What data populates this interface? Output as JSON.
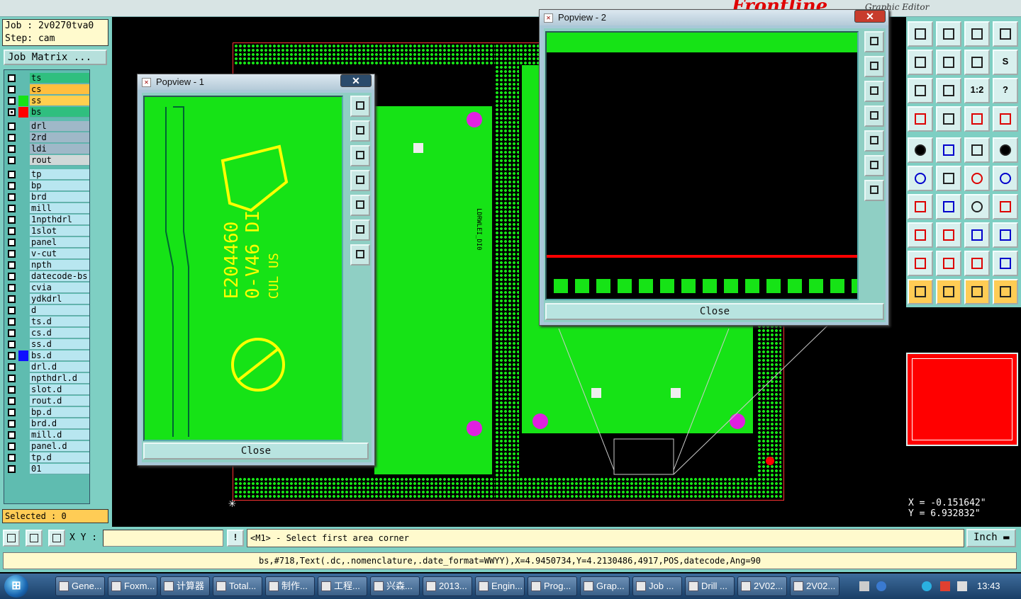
{
  "topbar": {
    "frontline": "Frontline",
    "subtitle": "Graphic Editor"
  },
  "left": {
    "job_line": "Job : 2v0270tva0",
    "step_line": "Step: cam",
    "job_matrix": "Job Matrix ...",
    "selected": "Selected : 0"
  },
  "layers": [
    {
      "name": "ts",
      "color": "#2fbf7f",
      "checked": false,
      "swatch": "",
      "mark": "◢"
    },
    {
      "name": "cs",
      "color": "#ffbf3f",
      "checked": false,
      "swatch": "",
      "mark": "◢"
    },
    {
      "name": "ss",
      "color": "#ffcf4f",
      "checked": false,
      "swatch": "#16e316",
      "mark": ""
    },
    {
      "name": "bs",
      "color": "#2fbf7f",
      "checked": true,
      "swatch": "#ff0000",
      "mark": "⊞"
    },
    {
      "name": "drl",
      "color": "#9fb8c8",
      "checked": false,
      "swatch": "",
      "mark": ""
    },
    {
      "name": "2rd",
      "color": "#9fb8c8",
      "checked": false,
      "swatch": "",
      "mark": ""
    },
    {
      "name": "ldi",
      "color": "#9fb8c8",
      "checked": false,
      "swatch": "",
      "mark": ""
    },
    {
      "name": "rout",
      "color": "#d0d8d8",
      "checked": false,
      "swatch": "",
      "mark": ""
    },
    {
      "name": "tp",
      "color": "#b8e6f0",
      "checked": false,
      "swatch": "",
      "mark": "◢"
    },
    {
      "name": "bp",
      "color": "#b8e6f0",
      "checked": false,
      "swatch": "",
      "mark": ""
    },
    {
      "name": "brd",
      "color": "#b8e6f0",
      "checked": false,
      "swatch": "",
      "mark": ""
    },
    {
      "name": "mill",
      "color": "#b8e6f0",
      "checked": false,
      "swatch": "",
      "mark": ""
    },
    {
      "name": "1npthdrl",
      "color": "#b8e6f0",
      "checked": false,
      "swatch": "",
      "mark": ""
    },
    {
      "name": "1slot",
      "color": "#b8e6f0",
      "checked": false,
      "swatch": "",
      "mark": ""
    },
    {
      "name": "panel",
      "color": "#b8e6f0",
      "checked": false,
      "swatch": "",
      "mark": ""
    },
    {
      "name": "v-cut",
      "color": "#b8e6f0",
      "checked": false,
      "swatch": "",
      "mark": ""
    },
    {
      "name": "npth",
      "color": "#b8e6f0",
      "checked": false,
      "swatch": "",
      "mark": ""
    },
    {
      "name": "datecode-bs",
      "color": "#b8e6f0",
      "checked": false,
      "swatch": "",
      "mark": ""
    },
    {
      "name": "cvia",
      "color": "#b8e6f0",
      "checked": false,
      "swatch": "",
      "mark": ""
    },
    {
      "name": "ydkdrl",
      "color": "#b8e6f0",
      "checked": false,
      "swatch": "",
      "mark": ""
    },
    {
      "name": "d",
      "color": "#b8e6f0",
      "checked": false,
      "swatch": "",
      "mark": ""
    },
    {
      "name": "ts.d",
      "color": "#b8e6f0",
      "checked": false,
      "swatch": "",
      "mark": "◢"
    },
    {
      "name": "cs.d",
      "color": "#b8e6f0",
      "checked": false,
      "swatch": "",
      "mark": "◢"
    },
    {
      "name": "ss.d",
      "color": "#b8e6f0",
      "checked": false,
      "swatch": "",
      "mark": ""
    },
    {
      "name": "bs.d",
      "color": "#b8e6f0",
      "checked": false,
      "swatch": "#1010ff",
      "mark": ""
    },
    {
      "name": "drl.d",
      "color": "#b8e6f0",
      "checked": false,
      "swatch": "",
      "mark": ""
    },
    {
      "name": "npthdrl.d",
      "color": "#b8e6f0",
      "checked": false,
      "swatch": "",
      "mark": ""
    },
    {
      "name": "slot.d",
      "color": "#b8e6f0",
      "checked": false,
      "swatch": "",
      "mark": ""
    },
    {
      "name": "rout.d",
      "color": "#b8e6f0",
      "checked": false,
      "swatch": "",
      "mark": ""
    },
    {
      "name": "bp.d",
      "color": "#b8e6f0",
      "checked": false,
      "swatch": "",
      "mark": ""
    },
    {
      "name": "brd.d",
      "color": "#b8e6f0",
      "checked": false,
      "swatch": "",
      "mark": ""
    },
    {
      "name": "mill.d",
      "color": "#b8e6f0",
      "checked": false,
      "swatch": "",
      "mark": ""
    },
    {
      "name": "panel.d",
      "color": "#b8e6f0",
      "checked": false,
      "swatch": "",
      "mark": ""
    },
    {
      "name": "tp.d",
      "color": "#b8e6f0",
      "checked": false,
      "swatch": "",
      "mark": "◢"
    },
    {
      "name": "01",
      "color": "#b8e6f0",
      "checked": false,
      "swatch": "",
      "mark": ""
    }
  ],
  "popview1": {
    "title": "Popview - 1",
    "close_label": "Close",
    "markings": [
      "E204460",
      "0-V46 DI",
      "CUL US"
    ]
  },
  "popview2": {
    "title": "Popview - 2",
    "close_label": "Close"
  },
  "canvas_text": [
    "LDRWLEI_DI0"
  ],
  "tools": [
    {
      "icon": "save-icon",
      "label": ""
    },
    {
      "icon": "open-icon",
      "label": ""
    },
    {
      "icon": "home-icon",
      "label": ""
    },
    {
      "icon": "window-icon",
      "label": ""
    },
    {
      "icon": "pan-left-icon",
      "label": ""
    },
    {
      "icon": "pan-right-icon",
      "label": ""
    },
    {
      "icon": "swap-icon",
      "label": ""
    },
    {
      "icon": "s-curve-icon",
      "label": "S"
    },
    {
      "icon": "zoom-fit-icon",
      "label": ""
    },
    {
      "icon": "zoom-icon",
      "label": ""
    },
    {
      "icon": "scale-icon",
      "label": "1:2"
    },
    {
      "icon": "help-icon",
      "label": "?"
    },
    {
      "icon": "measure-icon",
      "label": ""
    },
    {
      "icon": "probe-icon",
      "label": ""
    },
    {
      "icon": "net-icon",
      "label": ""
    },
    {
      "icon": "net2-icon",
      "label": ""
    },
    {
      "icon": "pad-icon",
      "label": ""
    },
    {
      "icon": "line-icon",
      "label": ""
    },
    {
      "icon": "ruler-icon",
      "label": ""
    },
    {
      "icon": "dot-icon",
      "label": ""
    },
    {
      "icon": "connect-icon",
      "label": ""
    },
    {
      "icon": "cross-icon",
      "label": ""
    },
    {
      "icon": "edge-icon",
      "label": ""
    },
    {
      "icon": "edge2-icon",
      "label": ""
    },
    {
      "icon": "angle-icon",
      "label": ""
    },
    {
      "icon": "diag-icon",
      "label": ""
    },
    {
      "icon": "rotate-icon",
      "label": ""
    },
    {
      "icon": "mirror-icon",
      "label": ""
    },
    {
      "icon": "shift-icon",
      "label": ""
    },
    {
      "icon": "minus-icon",
      "label": ""
    },
    {
      "icon": "stretch-icon",
      "label": ""
    },
    {
      "icon": "group-icon",
      "label": ""
    },
    {
      "icon": "triangle-icon",
      "label": ""
    },
    {
      "icon": "triangle2-icon",
      "label": ""
    },
    {
      "icon": "triangle3-icon",
      "label": ""
    },
    {
      "icon": "triangle4-icon",
      "label": ""
    },
    {
      "icon": "pointer-icon",
      "label": ""
    },
    {
      "icon": "pointer2-icon",
      "label": ""
    },
    {
      "icon": "pointer3-icon",
      "label": ""
    },
    {
      "icon": "pointer4-icon",
      "label": ""
    }
  ],
  "coords": {
    "x": "X = -0.151642\"",
    "y": "Y = 6.932832\""
  },
  "command": {
    "xy_label": "X Y :",
    "xy_value": "",
    "alert": "!",
    "prompt": "<M1> - Select first area corner",
    "units": "Inch"
  },
  "status_text": "bs,#718,Text(.dc,.nomenclature,.date_format=WWYY),X=4.9450734,Y=4.2130486,4917,POS,datecode,Ang=90",
  "taskbar": {
    "start": "⊞",
    "items": [
      "Gene...",
      "Foxm...",
      "计算器",
      "Total...",
      "制作...",
      "工程...",
      "兴森...",
      "2013...",
      "Engin...",
      "Prog...",
      "Grap...",
      "Job ...",
      "Drill ...",
      "2V02...",
      "2V02..."
    ],
    "clock": "13:43"
  }
}
